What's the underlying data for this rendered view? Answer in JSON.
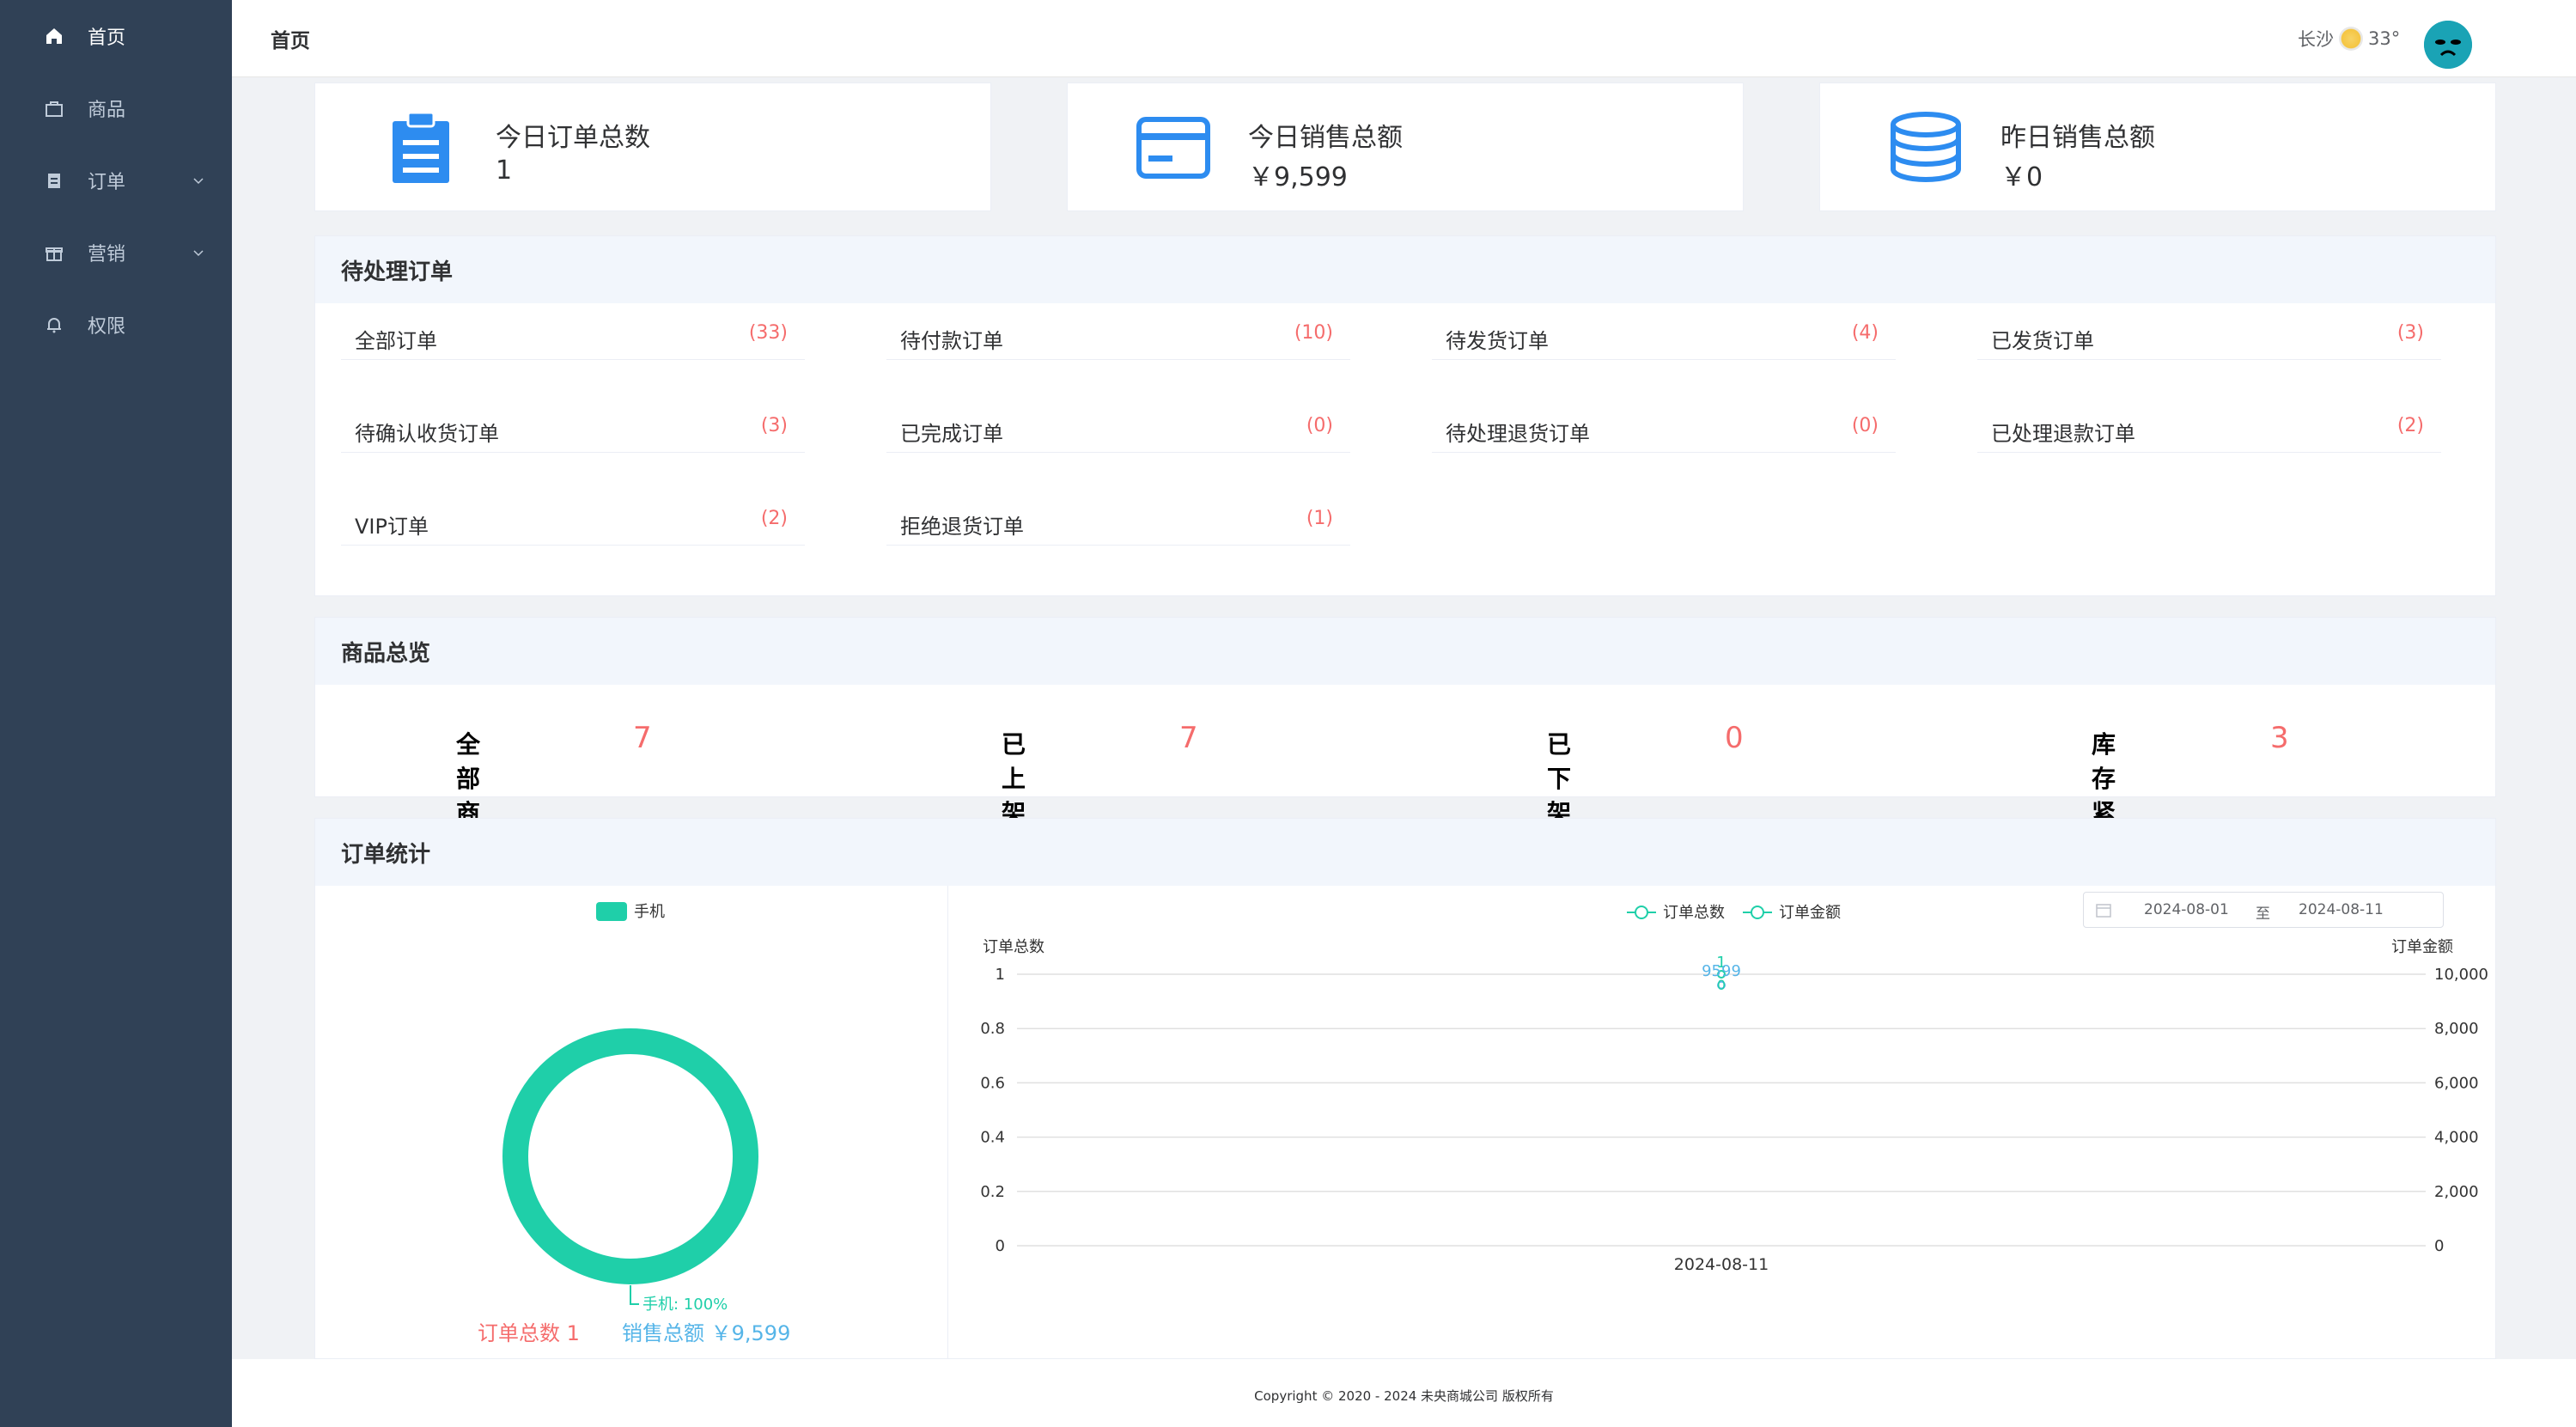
{
  "sidebar": {
    "items": [
      {
        "label": "首页",
        "icon": "home-icon",
        "active": true
      },
      {
        "label": "商品",
        "icon": "bag-icon"
      },
      {
        "label": "订单",
        "icon": "clipboard-icon",
        "expandable": true
      },
      {
        "label": "营销",
        "icon": "gift-icon",
        "expandable": true
      },
      {
        "label": "权限",
        "icon": "bell-icon"
      }
    ]
  },
  "header": {
    "title": "首页",
    "city": "长沙",
    "temperature": "33°"
  },
  "stats": [
    {
      "title": "今日订单总数",
      "value": "1",
      "icon": "clipboard-icon"
    },
    {
      "title": "今日销售总额",
      "value": "￥9,599",
      "icon": "credit-card-icon"
    },
    {
      "title": "昨日销售总额",
      "value": "￥0",
      "icon": "coins-stack-icon"
    }
  ],
  "pending_orders": {
    "title": "待处理订单",
    "items": [
      {
        "label": "全部订单",
        "count": "(33)"
      },
      {
        "label": "待付款订单",
        "count": "(10)"
      },
      {
        "label": "待发货订单",
        "count": "(4)"
      },
      {
        "label": "已发货订单",
        "count": "(3)"
      },
      {
        "label": "待确认收货订单",
        "count": "(3)"
      },
      {
        "label": "已完成订单",
        "count": "(0)"
      },
      {
        "label": "待处理退货订单",
        "count": "(0)"
      },
      {
        "label": "已处理退款订单",
        "count": "(2)"
      },
      {
        "label": "VIP订单",
        "count": "(2)"
      },
      {
        "label": "拒绝退货订单",
        "count": "(1)"
      }
    ]
  },
  "product_overview": {
    "title": "商品总览",
    "items": [
      {
        "label": "全部商品",
        "count": "7"
      },
      {
        "label": "已上架",
        "count": "7"
      },
      {
        "label": "已下架",
        "count": "0"
      },
      {
        "label": "库存紧张",
        "count": "3"
      }
    ]
  },
  "order_stats": {
    "title": "订单统计",
    "date_start": "2024-08-01",
    "date_sep": "至",
    "date_end": "2024-08-11",
    "order_total_label": "订单总数 1",
    "sales_total_label": "销售总额 ￥9,599"
  },
  "chart_data": [
    {
      "type": "pie",
      "legend": [
        "手机"
      ],
      "slices": [
        {
          "name": "手机",
          "value": 100,
          "label": "手机: 100%"
        }
      ],
      "colors": [
        "#1fcfa9"
      ]
    },
    {
      "type": "line",
      "legend": [
        "订单总数",
        "订单金额"
      ],
      "categories": [
        "2024-08-11"
      ],
      "series": [
        {
          "name": "订单总数",
          "values": [
            1
          ],
          "axis": "left"
        },
        {
          "name": "订单金额",
          "values": [
            9599
          ],
          "axis": "right"
        }
      ],
      "point_labels": [
        "1",
        "9599",
        "0"
      ],
      "ylabel_left": "订单总数",
      "ylabel_right": "订单金额",
      "yticks_left": [
        "0",
        "0.2",
        "0.4",
        "0.6",
        "0.8",
        "1"
      ],
      "yticks_right": [
        "0",
        "2,000",
        "4,000",
        "6,000",
        "8,000",
        "10,000"
      ],
      "ylim_left": [
        0,
        1
      ],
      "ylim_right": [
        0,
        10000
      ]
    }
  ],
  "footer": {
    "copyright": "Copyright © 2020 - 2024  未央商城公司 版权所有"
  },
  "colors": {
    "sidebar": "#304156",
    "accent": "#2d8cf0",
    "teal": "#1fcfa9",
    "red": "#f56c6c",
    "blue_text": "#56b5e8"
  }
}
